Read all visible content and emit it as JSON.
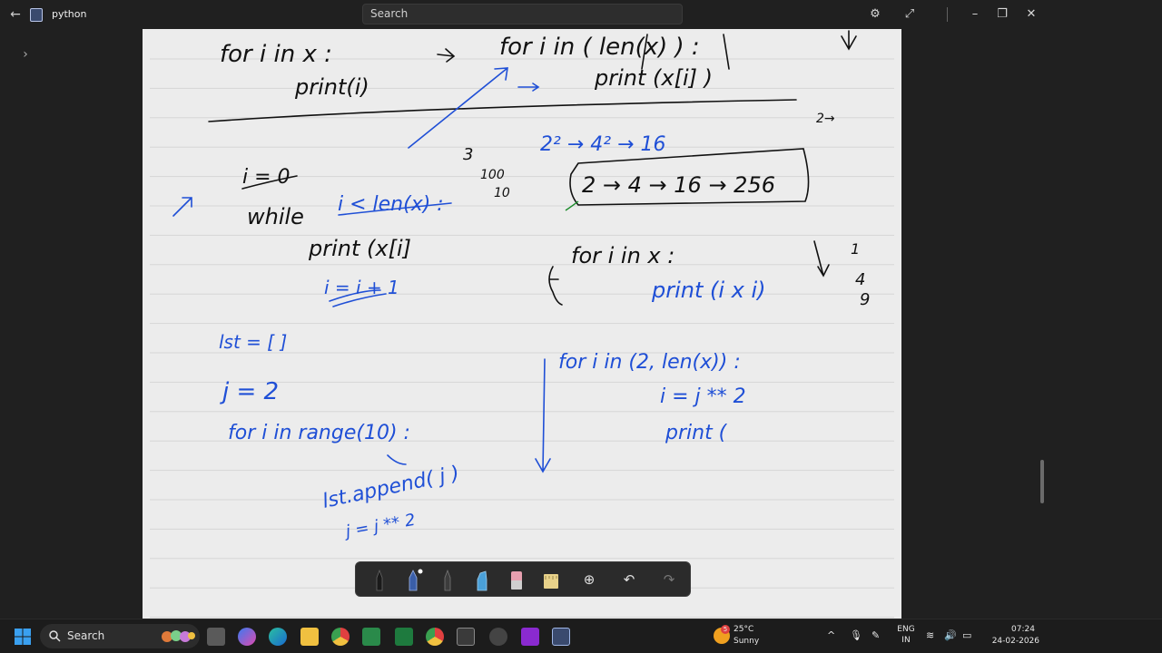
{
  "window": {
    "title": "python",
    "search_placeholder": "Search"
  },
  "note": {
    "ink_black": "#111111",
    "ink_blue": "#1f4fd6",
    "ink_green": "#1a8a2a",
    "line_color": "#d6d6d6",
    "lines": [
      {
        "text": "for  i  in  x :",
        "color": "black"
      },
      {
        "text": "print(i)",
        "color": "black"
      },
      {
        "text": "for  i  in  ( len(x) ) :",
        "color": "black"
      },
      {
        "text": "print (x[i] )",
        "color": "black"
      },
      {
        "text": "2→",
        "color": "black"
      },
      {
        "text": "i = 0",
        "color": "black"
      },
      {
        "text": "while",
        "color": "black"
      },
      {
        "text": "i < len(x) :",
        "color": "blue"
      },
      {
        "text": "print (x[i]",
        "color": "black"
      },
      {
        "text": "i = i + 1",
        "color": "blue"
      },
      {
        "text": "3",
        "color": "black"
      },
      {
        "text": "100",
        "color": "black"
      },
      {
        "text": "10",
        "color": "black"
      },
      {
        "text": "2² → 4² → 16",
        "color": "blue"
      },
      {
        "text": "2 → 4 → 16 → 256",
        "color": "black"
      },
      {
        "text": "for  i  in x :",
        "color": "black"
      },
      {
        "text": "print (i x i)",
        "color": "blue"
      },
      {
        "text": "1",
        "color": "black"
      },
      {
        "text": "4",
        "color": "black"
      },
      {
        "text": "9",
        "color": "black"
      },
      {
        "text": "lst = [ ]",
        "color": "blue"
      },
      {
        "text": "j = 2",
        "color": "blue"
      },
      {
        "text": "for   i   in range(10) :",
        "color": "blue"
      },
      {
        "text": "lst.append( j )",
        "color": "blue"
      },
      {
        "text": "j = j ** 2",
        "color": "blue"
      },
      {
        "text": "for  i   in   (2, len(x)) :",
        "color": "blue"
      },
      {
        "text": "i = j ** 2",
        "color": "blue"
      },
      {
        "text": "print (",
        "color": "blue"
      }
    ]
  },
  "pen_toolbar": {
    "tools": [
      "pen-black",
      "pen-blue",
      "pencil",
      "highlighter",
      "eraser",
      "ruler"
    ],
    "add_symbol": "⊕",
    "undo_symbol": "↶",
    "redo_symbol": "↷"
  },
  "taskbar": {
    "search_label": "Search",
    "weather_temp": "25°C",
    "weather_desc": "Sunny",
    "weather_badge": "5",
    "lang_line1": "ENG",
    "lang_line2": "IN",
    "time": "07:24",
    "date": "24-02-2026"
  }
}
